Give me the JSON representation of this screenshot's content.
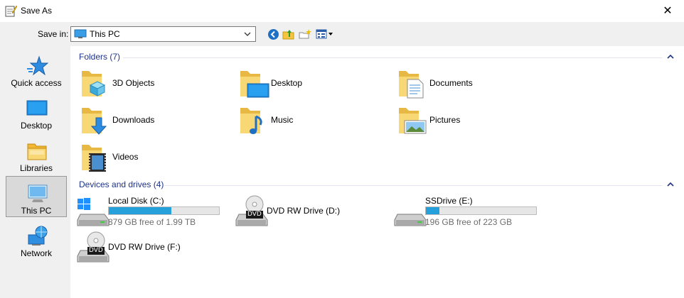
{
  "window": {
    "title": "Save As",
    "close_glyph": "✕"
  },
  "toolbar": {
    "save_in_label": "Save in:",
    "location": "This PC",
    "buttons": [
      "back-icon",
      "up-folder-icon",
      "new-folder-icon",
      "view-menu-icon"
    ]
  },
  "places": [
    {
      "label": "Quick access",
      "icon": "star-icon"
    },
    {
      "label": "Desktop",
      "icon": "desktop-icon"
    },
    {
      "label": "Libraries",
      "icon": "libraries-icon"
    },
    {
      "label": "This PC",
      "icon": "pc-icon",
      "selected": true
    },
    {
      "label": "Network",
      "icon": "network-icon"
    }
  ],
  "folders": {
    "title": "Folders (7)",
    "items": [
      {
        "label": "3D Objects",
        "icon": "3d-objects-folder-icon"
      },
      {
        "label": "Desktop",
        "icon": "desktop-folder-icon"
      },
      {
        "label": "Documents",
        "icon": "documents-folder-icon"
      },
      {
        "label": "Downloads",
        "icon": "downloads-folder-icon"
      },
      {
        "label": "Music",
        "icon": "music-folder-icon"
      },
      {
        "label": "Pictures",
        "icon": "pictures-folder-icon"
      },
      {
        "label": "Videos",
        "icon": "videos-folder-icon"
      }
    ]
  },
  "drives": {
    "title": "Devices and drives (4)",
    "items": [
      {
        "label": "Local Disk (C:)",
        "free": "879 GB free of 1.99 TB",
        "used_fraction": 0.57,
        "icon": "windows-disk-icon"
      },
      {
        "label": "DVD RW Drive (D:)",
        "icon": "dvd-drive-icon"
      },
      {
        "label": "SSDrive (E:)",
        "free": "196 GB free of 223 GB",
        "used_fraction": 0.12,
        "icon": "disk-icon"
      },
      {
        "label": "DVD RW Drive (F:)",
        "icon": "dvd-drive-icon"
      }
    ],
    "dvd_badge": "DVD"
  },
  "colors": {
    "accent": "#26a0da",
    "group_title": "#1e3287",
    "folder": "#f8d775"
  }
}
